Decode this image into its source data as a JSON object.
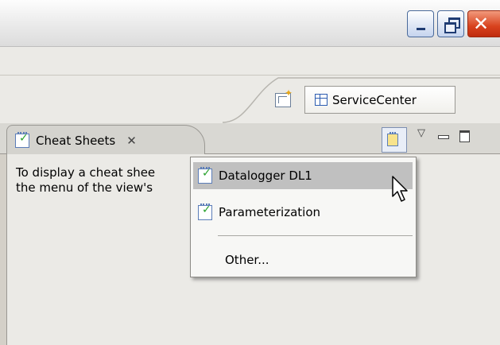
{
  "window": {
    "minimize_icon": "minimize-icon",
    "restore_icon": "restore-icon",
    "close_icon": "close-icon",
    "close_color": "#d8421e"
  },
  "toolbar": {
    "perspective_label": "ServiceCenter"
  },
  "view": {
    "tab_title": "Cheat Sheets",
    "tab_close_glyph": "✕",
    "body_line1": "To display a cheat shee                                               enu or from",
    "body_line2": "the menu of the view's"
  },
  "menu": {
    "items": [
      {
        "label": "Datalogger DL1",
        "icon": "cheat-sheet-icon",
        "highlighted": true
      },
      {
        "label": "Parameterization",
        "icon": "cheat-sheet-icon",
        "highlighted": false
      },
      {
        "label": "Other...",
        "icon": null,
        "highlighted": false
      }
    ],
    "highlight_color": "#c0c0c0"
  }
}
